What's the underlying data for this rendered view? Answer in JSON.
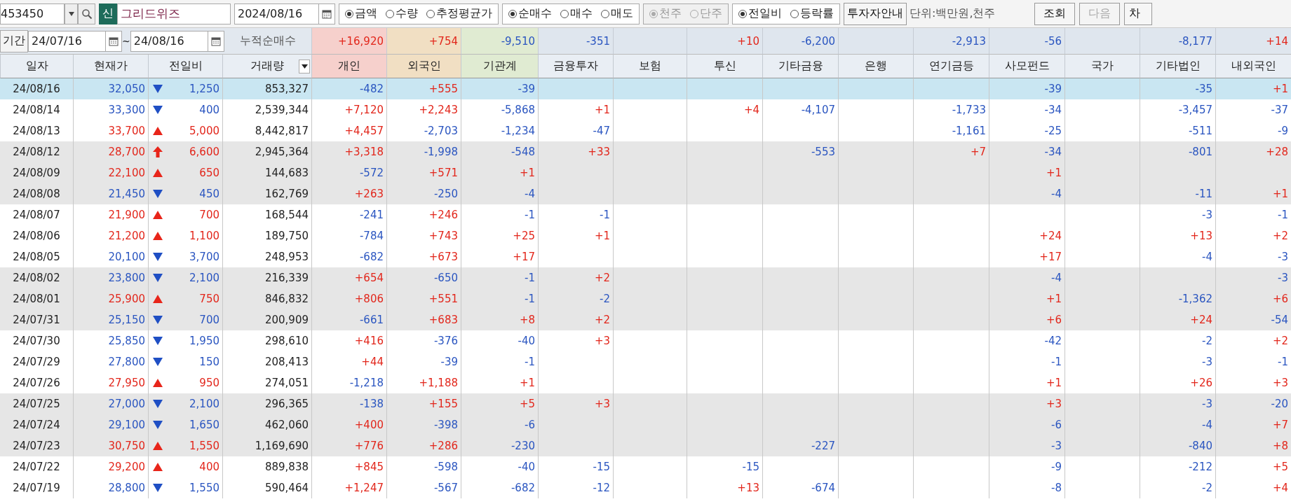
{
  "toolbar": {
    "code": "453450",
    "badge": "신",
    "name": "그리드위즈",
    "date": "2024/08/16",
    "radio_groups": [
      {
        "disabled": false,
        "options": [
          {
            "label": "금액",
            "selected": true
          },
          {
            "label": "수량",
            "selected": false
          },
          {
            "label": "추정평균가",
            "selected": false
          }
        ]
      },
      {
        "disabled": false,
        "options": [
          {
            "label": "순매수",
            "selected": true
          },
          {
            "label": "매수",
            "selected": false
          },
          {
            "label": "매도",
            "selected": false
          }
        ]
      },
      {
        "disabled": true,
        "options": [
          {
            "label": "천주",
            "selected": true
          },
          {
            "label": "단주",
            "selected": false
          }
        ]
      },
      {
        "disabled": false,
        "options": [
          {
            "label": "전일비",
            "selected": true
          },
          {
            "label": "등락률",
            "selected": false
          }
        ]
      }
    ],
    "guide_button": "투자자안내",
    "unit_label": "단위:백만원,천주",
    "buttons": [
      {
        "label": "조회",
        "disabled": false
      },
      {
        "label": "다음",
        "disabled": true
      },
      {
        "label": "차",
        "disabled": false
      }
    ]
  },
  "period": {
    "label": "기간",
    "from": "24/07/16",
    "separator": "~",
    "to": "24/08/16",
    "sum_label": "누적순매수",
    "totals": {
      "individual": "+16,920",
      "foreigner": "+754",
      "institution": "-9,510",
      "financial_investment": "-351",
      "investment_trust": "+10",
      "other_finance": "-6,200",
      "pension": "-2,913",
      "private_fund": "-56",
      "other_corporation": "-8,177",
      "other_foreigner": "+14"
    }
  },
  "table": {
    "columns": [
      {
        "label": "일자",
        "kind": "plain"
      },
      {
        "label": "현재가",
        "kind": "plain"
      },
      {
        "label": "전일비",
        "kind": "plain"
      },
      {
        "label": "거래량",
        "kind": "menu"
      },
      {
        "label": "개인",
        "kind": "plain",
        "color": "#f6d0cc"
      },
      {
        "label": "외국인",
        "kind": "plain",
        "color": "#f1dfc3"
      },
      {
        "label": "기관계",
        "kind": "plain",
        "color": "#e0ebd2"
      },
      {
        "label": "금융투자",
        "kind": "plain"
      },
      {
        "label": "보험",
        "kind": "plain"
      },
      {
        "label": "투신",
        "kind": "plain"
      },
      {
        "label": "기타금융",
        "kind": "plain"
      },
      {
        "label": "은행",
        "kind": "plain"
      },
      {
        "label": "연기금등",
        "kind": "plain"
      },
      {
        "label": "사모펀드",
        "kind": "plain"
      },
      {
        "label": "국가",
        "kind": "plain"
      },
      {
        "label": "기타법인",
        "kind": "plain"
      },
      {
        "label": "내외국인",
        "kind": "plain"
      }
    ],
    "rows": [
      {
        "date": "24/08/16",
        "price": "32,050",
        "kind": "down",
        "change": "1,250",
        "volume": "853,327",
        "selected": true,
        "values": {
          "individual": "-482",
          "foreigner": "+555",
          "institution": "-39",
          "private_fund": "-39",
          "other_corporation": "-35",
          "other_foreigner": "+1"
        }
      },
      {
        "date": "24/08/14",
        "price": "33,300",
        "kind": "down",
        "change": "400",
        "volume": "2,539,344",
        "selected": false,
        "shaded": false,
        "values": {
          "individual": "+7,120",
          "foreigner": "+2,243",
          "institution": "-5,868",
          "financial_investment": "+1",
          "investment_trust": "+4",
          "other_finance": "-4,107",
          "pension": "-1,733",
          "private_fund": "-34",
          "other_corporation": "-3,457",
          "other_foreigner": "-37"
        }
      },
      {
        "date": "24/08/13",
        "price": "33,700",
        "kind": "up",
        "change": "5,000",
        "volume": "8,442,817",
        "selected": false,
        "shaded": false,
        "values": {
          "individual": "+4,457",
          "foreigner": "-2,703",
          "institution": "-1,234",
          "financial_investment": "-47",
          "pension": "-1,161",
          "private_fund": "-25",
          "other_corporation": "-511",
          "other_foreigner": "-9"
        }
      },
      {
        "date": "24/08/12",
        "price": "28,700",
        "kind": "limit_up",
        "change": "6,600",
        "volume": "2,945,364",
        "selected": false,
        "shaded": true,
        "values": {
          "individual": "+3,318",
          "foreigner": "-1,998",
          "institution": "-548",
          "financial_investment": "+33",
          "other_finance": "-553",
          "pension": "+7",
          "private_fund": "-34",
          "other_corporation": "-801",
          "other_foreigner": "+28"
        }
      },
      {
        "date": "24/08/09",
        "price": "22,100",
        "kind": "up",
        "change": "650",
        "volume": "144,683",
        "selected": false,
        "shaded": true,
        "values": {
          "individual": "-572",
          "foreigner": "+571",
          "institution": "+1",
          "private_fund": "+1"
        }
      },
      {
        "date": "24/08/08",
        "price": "21,450",
        "kind": "down",
        "change": "450",
        "volume": "162,769",
        "selected": false,
        "shaded": true,
        "values": {
          "individual": "+263",
          "foreigner": "-250",
          "institution": "-4",
          "private_fund": "-4",
          "other_corporation": "-11",
          "other_foreigner": "+1"
        }
      },
      {
        "date": "24/08/07",
        "price": "21,900",
        "kind": "up",
        "change": "700",
        "volume": "168,544",
        "selected": false,
        "shaded": false,
        "values": {
          "individual": "-241",
          "foreigner": "+246",
          "institution": "-1",
          "financial_investment": "-1",
          "other_corporation": "-3",
          "other_foreigner": "-1"
        }
      },
      {
        "date": "24/08/06",
        "price": "21,200",
        "kind": "up",
        "change": "1,100",
        "volume": "189,750",
        "selected": false,
        "shaded": false,
        "values": {
          "individual": "-784",
          "foreigner": "+743",
          "institution": "+25",
          "financial_investment": "+1",
          "private_fund": "+24",
          "other_corporation": "+13",
          "other_foreigner": "+2"
        }
      },
      {
        "date": "24/08/05",
        "price": "20,100",
        "kind": "down",
        "change": "3,700",
        "volume": "248,953",
        "selected": false,
        "shaded": false,
        "values": {
          "individual": "-682",
          "foreigner": "+673",
          "institution": "+17",
          "private_fund": "+17",
          "other_corporation": "-4",
          "other_foreigner": "-3"
        }
      },
      {
        "date": "24/08/02",
        "price": "23,800",
        "kind": "down",
        "change": "2,100",
        "volume": "216,339",
        "selected": false,
        "shaded": true,
        "values": {
          "individual": "+654",
          "foreigner": "-650",
          "institution": "-1",
          "financial_investment": "+2",
          "private_fund": "-4",
          "other_foreigner": "-3"
        }
      },
      {
        "date": "24/08/01",
        "price": "25,900",
        "kind": "up",
        "change": "750",
        "volume": "846,832",
        "selected": false,
        "shaded": true,
        "values": {
          "individual": "+806",
          "foreigner": "+551",
          "institution": "-1",
          "financial_investment": "-2",
          "private_fund": "+1",
          "other_corporation": "-1,362",
          "other_foreigner": "+6"
        }
      },
      {
        "date": "24/07/31",
        "price": "25,150",
        "kind": "down",
        "change": "700",
        "volume": "200,909",
        "selected": false,
        "shaded": true,
        "values": {
          "individual": "-661",
          "foreigner": "+683",
          "institution": "+8",
          "financial_investment": "+2",
          "private_fund": "+6",
          "other_corporation": "+24",
          "other_foreigner": "-54"
        }
      },
      {
        "date": "24/07/30",
        "price": "25,850",
        "kind": "down",
        "change": "1,950",
        "volume": "298,610",
        "selected": false,
        "shaded": false,
        "values": {
          "individual": "+416",
          "foreigner": "-376",
          "institution": "-40",
          "financial_investment": "+3",
          "private_fund": "-42",
          "other_corporation": "-2",
          "other_foreigner": "+2"
        }
      },
      {
        "date": "24/07/29",
        "price": "27,800",
        "kind": "down",
        "change": "150",
        "volume": "208,413",
        "selected": false,
        "shaded": false,
        "values": {
          "individual": "+44",
          "foreigner": "-39",
          "institution": "-1",
          "private_fund": "-1",
          "other_corporation": "-3",
          "other_foreigner": "-1"
        }
      },
      {
        "date": "24/07/26",
        "price": "27,950",
        "kind": "up",
        "change": "950",
        "volume": "274,051",
        "selected": false,
        "shaded": false,
        "values": {
          "individual": "-1,218",
          "foreigner": "+1,188",
          "institution": "+1",
          "private_fund": "+1",
          "other_corporation": "+26",
          "other_foreigner": "+3"
        }
      },
      {
        "date": "24/07/25",
        "price": "27,000",
        "kind": "down",
        "change": "2,100",
        "volume": "296,365",
        "selected": false,
        "shaded": true,
        "values": {
          "individual": "-138",
          "foreigner": "+155",
          "institution": "+5",
          "financial_investment": "+3",
          "private_fund": "+3",
          "other_corporation": "-3",
          "other_foreigner": "-20"
        }
      },
      {
        "date": "24/07/24",
        "price": "29,100",
        "kind": "down",
        "change": "1,650",
        "volume": "462,060",
        "selected": false,
        "shaded": true,
        "values": {
          "individual": "+400",
          "foreigner": "-398",
          "institution": "-6",
          "private_fund": "-6",
          "other_corporation": "-4",
          "other_foreigner": "+7"
        }
      },
      {
        "date": "24/07/23",
        "price": "30,750",
        "kind": "up",
        "change": "1,550",
        "volume": "1,169,690",
        "selected": false,
        "shaded": true,
        "values": {
          "individual": "+776",
          "foreigner": "+286",
          "institution": "-230",
          "other_finance": "-227",
          "private_fund": "-3",
          "other_corporation": "-840",
          "other_foreigner": "+8"
        }
      },
      {
        "date": "24/07/22",
        "price": "29,200",
        "kind": "up",
        "change": "400",
        "volume": "889,838",
        "selected": false,
        "shaded": false,
        "values": {
          "individual": "+845",
          "foreigner": "-598",
          "institution": "-40",
          "financial_investment": "-15",
          "investment_trust": "-15",
          "private_fund": "-9",
          "other_corporation": "-212",
          "other_foreigner": "+5"
        }
      },
      {
        "date": "24/07/19",
        "price": "28,800",
        "kind": "down",
        "change": "1,550",
        "volume": "590,464",
        "selected": false,
        "shaded": false,
        "values": {
          "individual": "+1,247",
          "foreigner": "-567",
          "institution": "-682",
          "financial_investment": "-12",
          "investment_trust": "+13",
          "other_finance": "-674",
          "private_fund": "-8",
          "other_corporation": "-2",
          "other_foreigner": "+4"
        }
      }
    ]
  }
}
